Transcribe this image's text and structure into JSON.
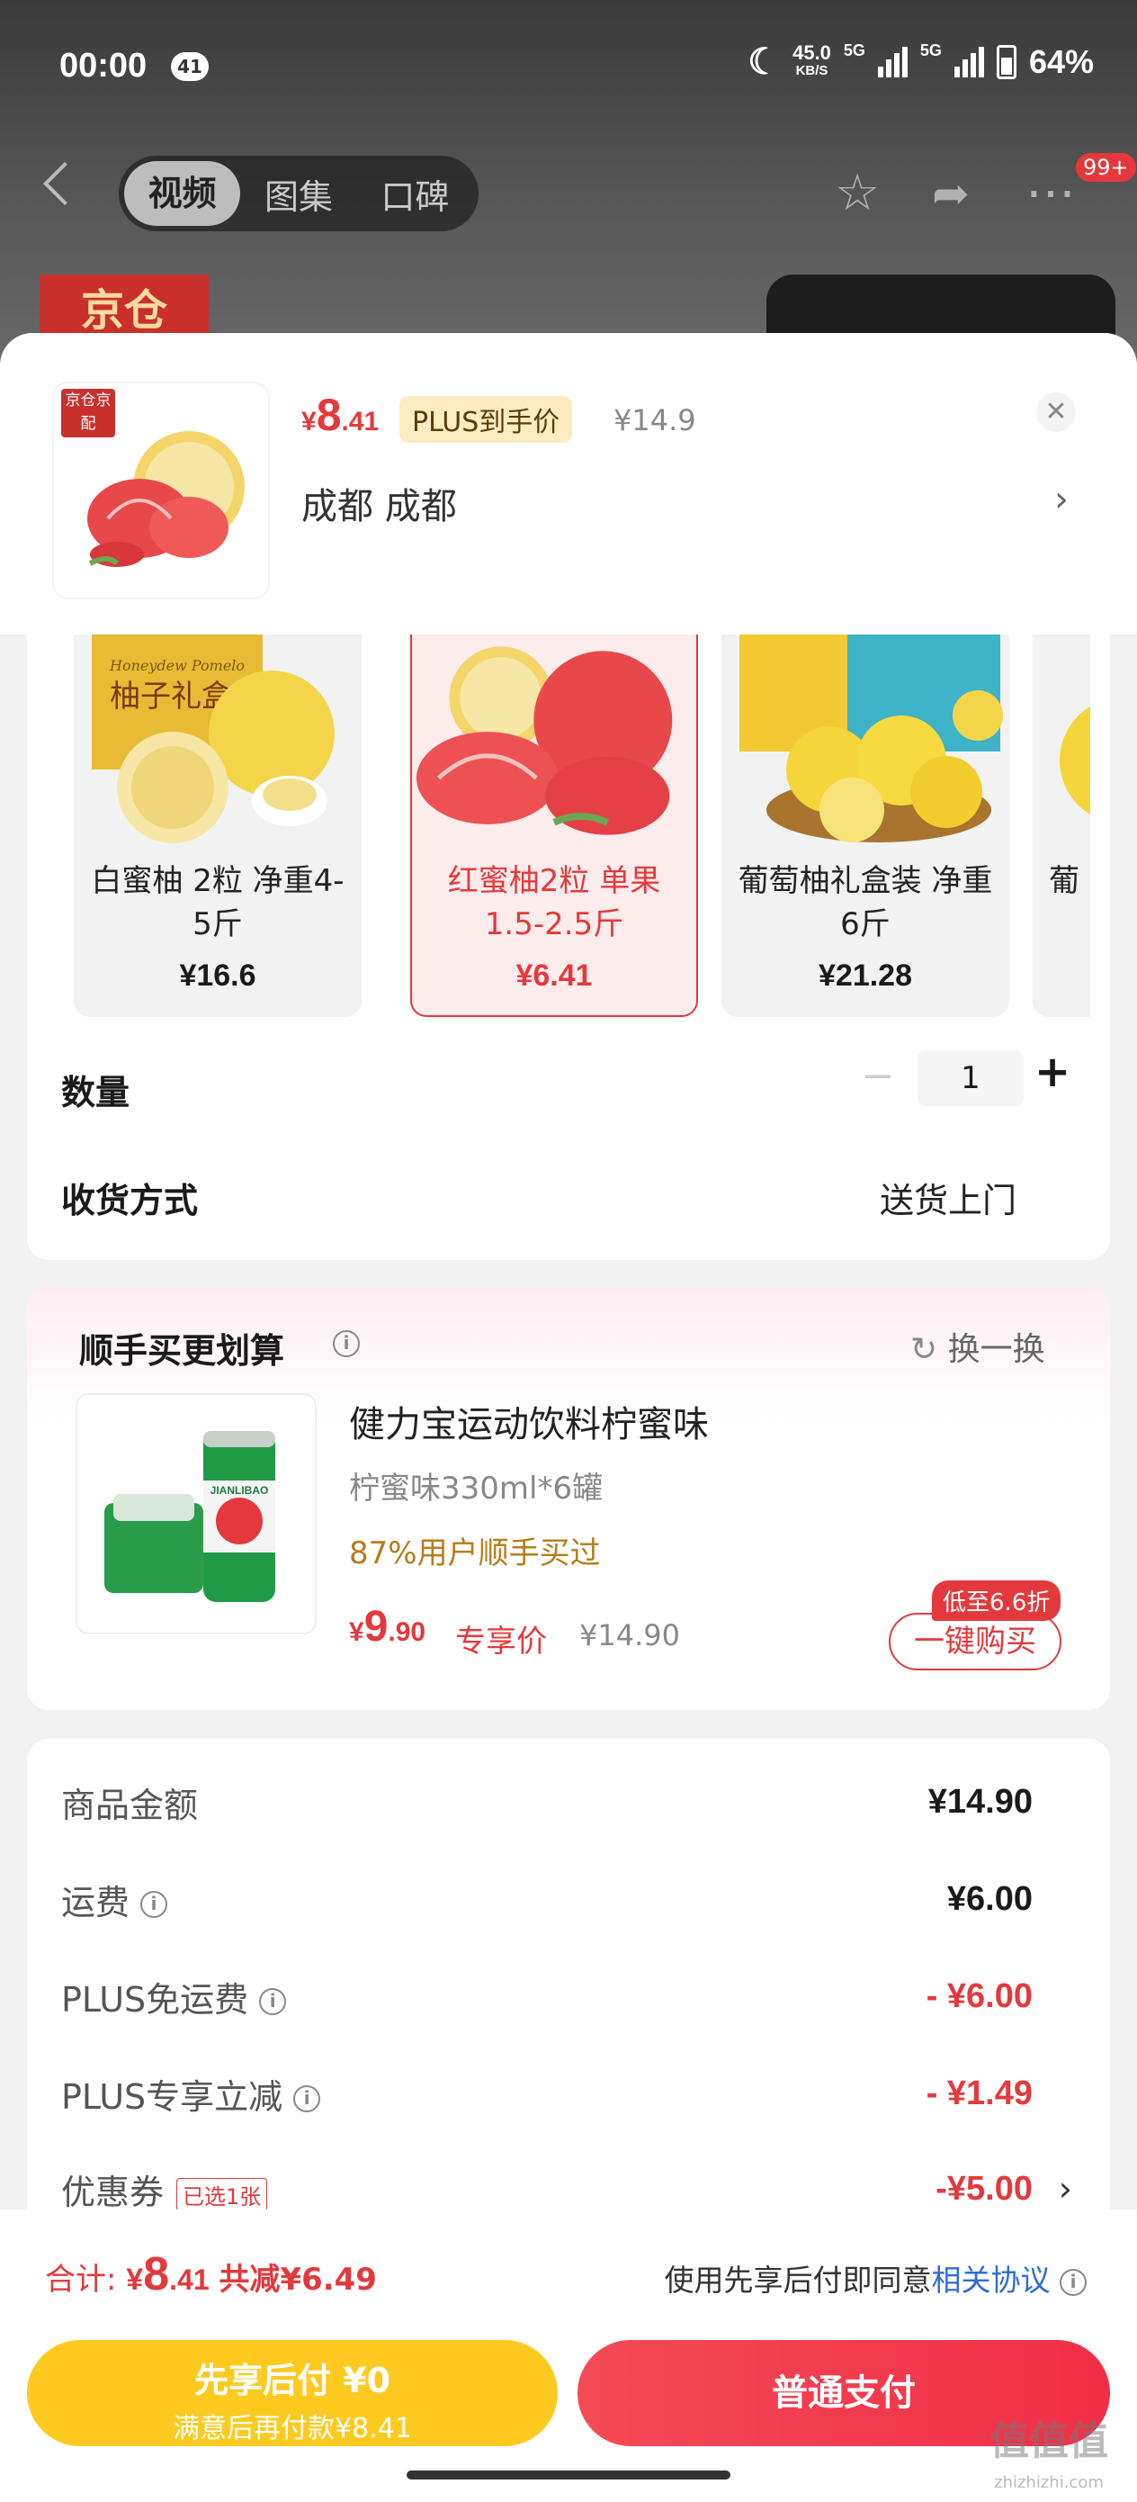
{
  "status_bar": {
    "time": "00:00",
    "notification_count": "41",
    "net_speed": "45.0",
    "net_speed_unit": "KB/S",
    "sig1": "5G",
    "sig2": "5G",
    "battery": "64%"
  },
  "nav": {
    "tabs": [
      "视频",
      "图集",
      "口碑"
    ],
    "badge": "99+"
  },
  "bg": {
    "logo_text": "京仓"
  },
  "product": {
    "badge": "京仓京配",
    "price_currency": "¥",
    "price_int": "8",
    "price_dec": ".41",
    "plus_label": "PLUS到手价",
    "original_price": "¥14.9",
    "location": "成都  成都"
  },
  "variants": [
    {
      "name": "白蜜柚 2粒 净重4-5斤",
      "price": "¥16.6",
      "selected": false
    },
    {
      "name": "红蜜柚2粒 单果1.5-2.5斤",
      "price": "¥6.41",
      "selected": true
    },
    {
      "name": "葡萄柚礼盒装 净重6斤",
      "price": "¥21.28",
      "selected": false
    },
    {
      "name": "葡",
      "price": "",
      "selected": false
    }
  ],
  "quantity": {
    "label": "数量",
    "value": "1"
  },
  "shipping": {
    "label": "收货方式",
    "value": "送货上门"
  },
  "addon": {
    "title": "顺手买更划算",
    "swap_label": "换一换",
    "name": "健力宝运动饮料柠蜜味",
    "spec": "柠蜜味330ml*6罐",
    "bought": "87%用户顺手买过",
    "price_currency": "¥",
    "price_int": "9",
    "price_dec": ".90",
    "exclusive": "专享价",
    "old_price": "¥14.90",
    "discount_tag": "低至6.6折",
    "buy_label": "一键购买"
  },
  "summary": [
    {
      "label": "商品金额",
      "value": "¥14.90",
      "info": false,
      "red": false
    },
    {
      "label": "运费",
      "value": "¥6.00",
      "info": true,
      "red": false
    },
    {
      "label": "PLUS免运费",
      "value": "- ¥6.00",
      "info": true,
      "red": true
    },
    {
      "label": "PLUS专享立减",
      "value": "- ¥1.49",
      "info": true,
      "red": true
    },
    {
      "label": "优惠券",
      "value": "-¥5.00",
      "info": false,
      "red": true,
      "tag": "已选1张"
    }
  ],
  "footer": {
    "total_label": "合计:",
    "total_currency": "¥",
    "total_int": "8",
    "total_dec": ".41",
    "saved": "共减¥6.49",
    "agree_text": "使用先享后付即同意",
    "agree_link": "相关协议",
    "pay_later_title": "先享后付 ¥0",
    "pay_later_sub": "满意后再付款¥8.41",
    "pay_now": "普通支付"
  },
  "watermark": {
    "logo": "值值值",
    "site": "zhizhizhi.com"
  },
  "colors": {
    "accent": "#e4393c",
    "gold": "#ffca1f",
    "plus_bg": "#fdecc2",
    "link": "#2e6bd8"
  }
}
